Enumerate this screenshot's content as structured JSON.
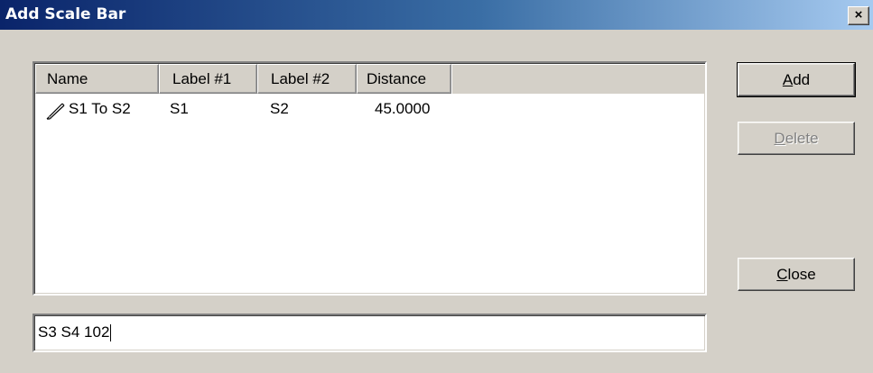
{
  "window": {
    "title": "Add Scale Bar",
    "close_label": "×"
  },
  "list": {
    "columns": [
      "Name",
      "Label #1",
      "Label #2",
      "Distance"
    ],
    "rows": [
      {
        "icon": "pencil-icon",
        "name": "S1 To S2",
        "label1": "S1",
        "label2": "S2",
        "distance": "45.0000"
      }
    ]
  },
  "buttons": {
    "add": {
      "prefix": "",
      "mnemonic": "A",
      "rest": "dd",
      "enabled": true
    },
    "delete": {
      "prefix": "",
      "mnemonic": "D",
      "rest": "elete",
      "enabled": false
    },
    "close": {
      "prefix": "",
      "mnemonic": "C",
      "rest": "lose",
      "enabled": true
    }
  },
  "input": {
    "value": "S3 S4 102"
  },
  "colors": {
    "titlebar_start": "#0a246a",
    "titlebar_end": "#a6caf0",
    "face": "#d4d0c8",
    "disabled_text": "#808080"
  }
}
